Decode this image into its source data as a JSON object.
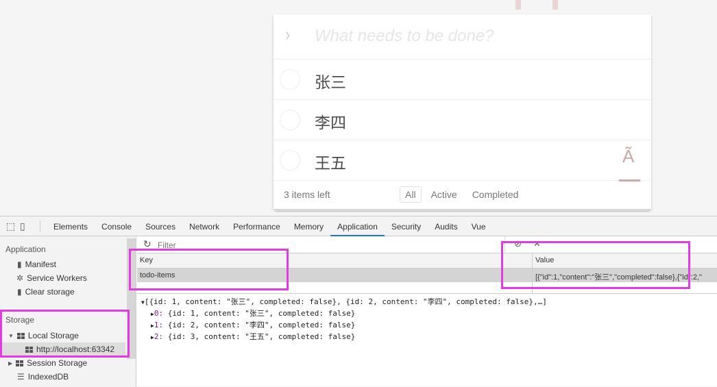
{
  "todo": {
    "placeholder": "What needs to be done?",
    "items": [
      {
        "content": "张三",
        "completed": false
      },
      {
        "content": "李四",
        "completed": false
      },
      {
        "content": "王五",
        "completed": false
      }
    ],
    "items_left": "3 items left",
    "filters": [
      "All",
      "Active",
      "Completed"
    ],
    "selected_filter": "All",
    "stray_glyph": "Ã"
  },
  "devtools": {
    "tabs": [
      "Elements",
      "Console",
      "Sources",
      "Network",
      "Performance",
      "Memory",
      "Application",
      "Security",
      "Audits",
      "Vue"
    ],
    "active_tab": "Application",
    "sidebar": {
      "application_header": "Application",
      "application_items": [
        "Manifest",
        "Service Workers",
        "Clear storage"
      ],
      "storage_header": "Storage",
      "local_storage": "Local Storage",
      "local_origin": "http://localhost:63342",
      "session_storage": "Session Storage",
      "indexeddb": "IndexedDB"
    },
    "filter_placeholder": "Filter",
    "columns": {
      "key": "Key",
      "value": "Value"
    },
    "row": {
      "key": "todo-items",
      "value": "[{\"id\":1,\"content\":\"张三\",\"completed\":false},{\"id\":2,\""
    },
    "preview": {
      "summary": "[{id: 1, content: \"张三\", completed: false}, {id: 2, content: \"李四\", completed: false},…]",
      "entries": [
        {
          "idx": "0:",
          "text": " {id: 1, content: \"张三\", completed: false}"
        },
        {
          "idx": "1:",
          "text": " {id: 2, content: \"李四\", completed: false}"
        },
        {
          "idx": "2:",
          "text": " {id: 3, content: \"王五\", completed: false}"
        }
      ]
    },
    "highlight_color": "#e23be2",
    "accent": "#1a73e8"
  }
}
